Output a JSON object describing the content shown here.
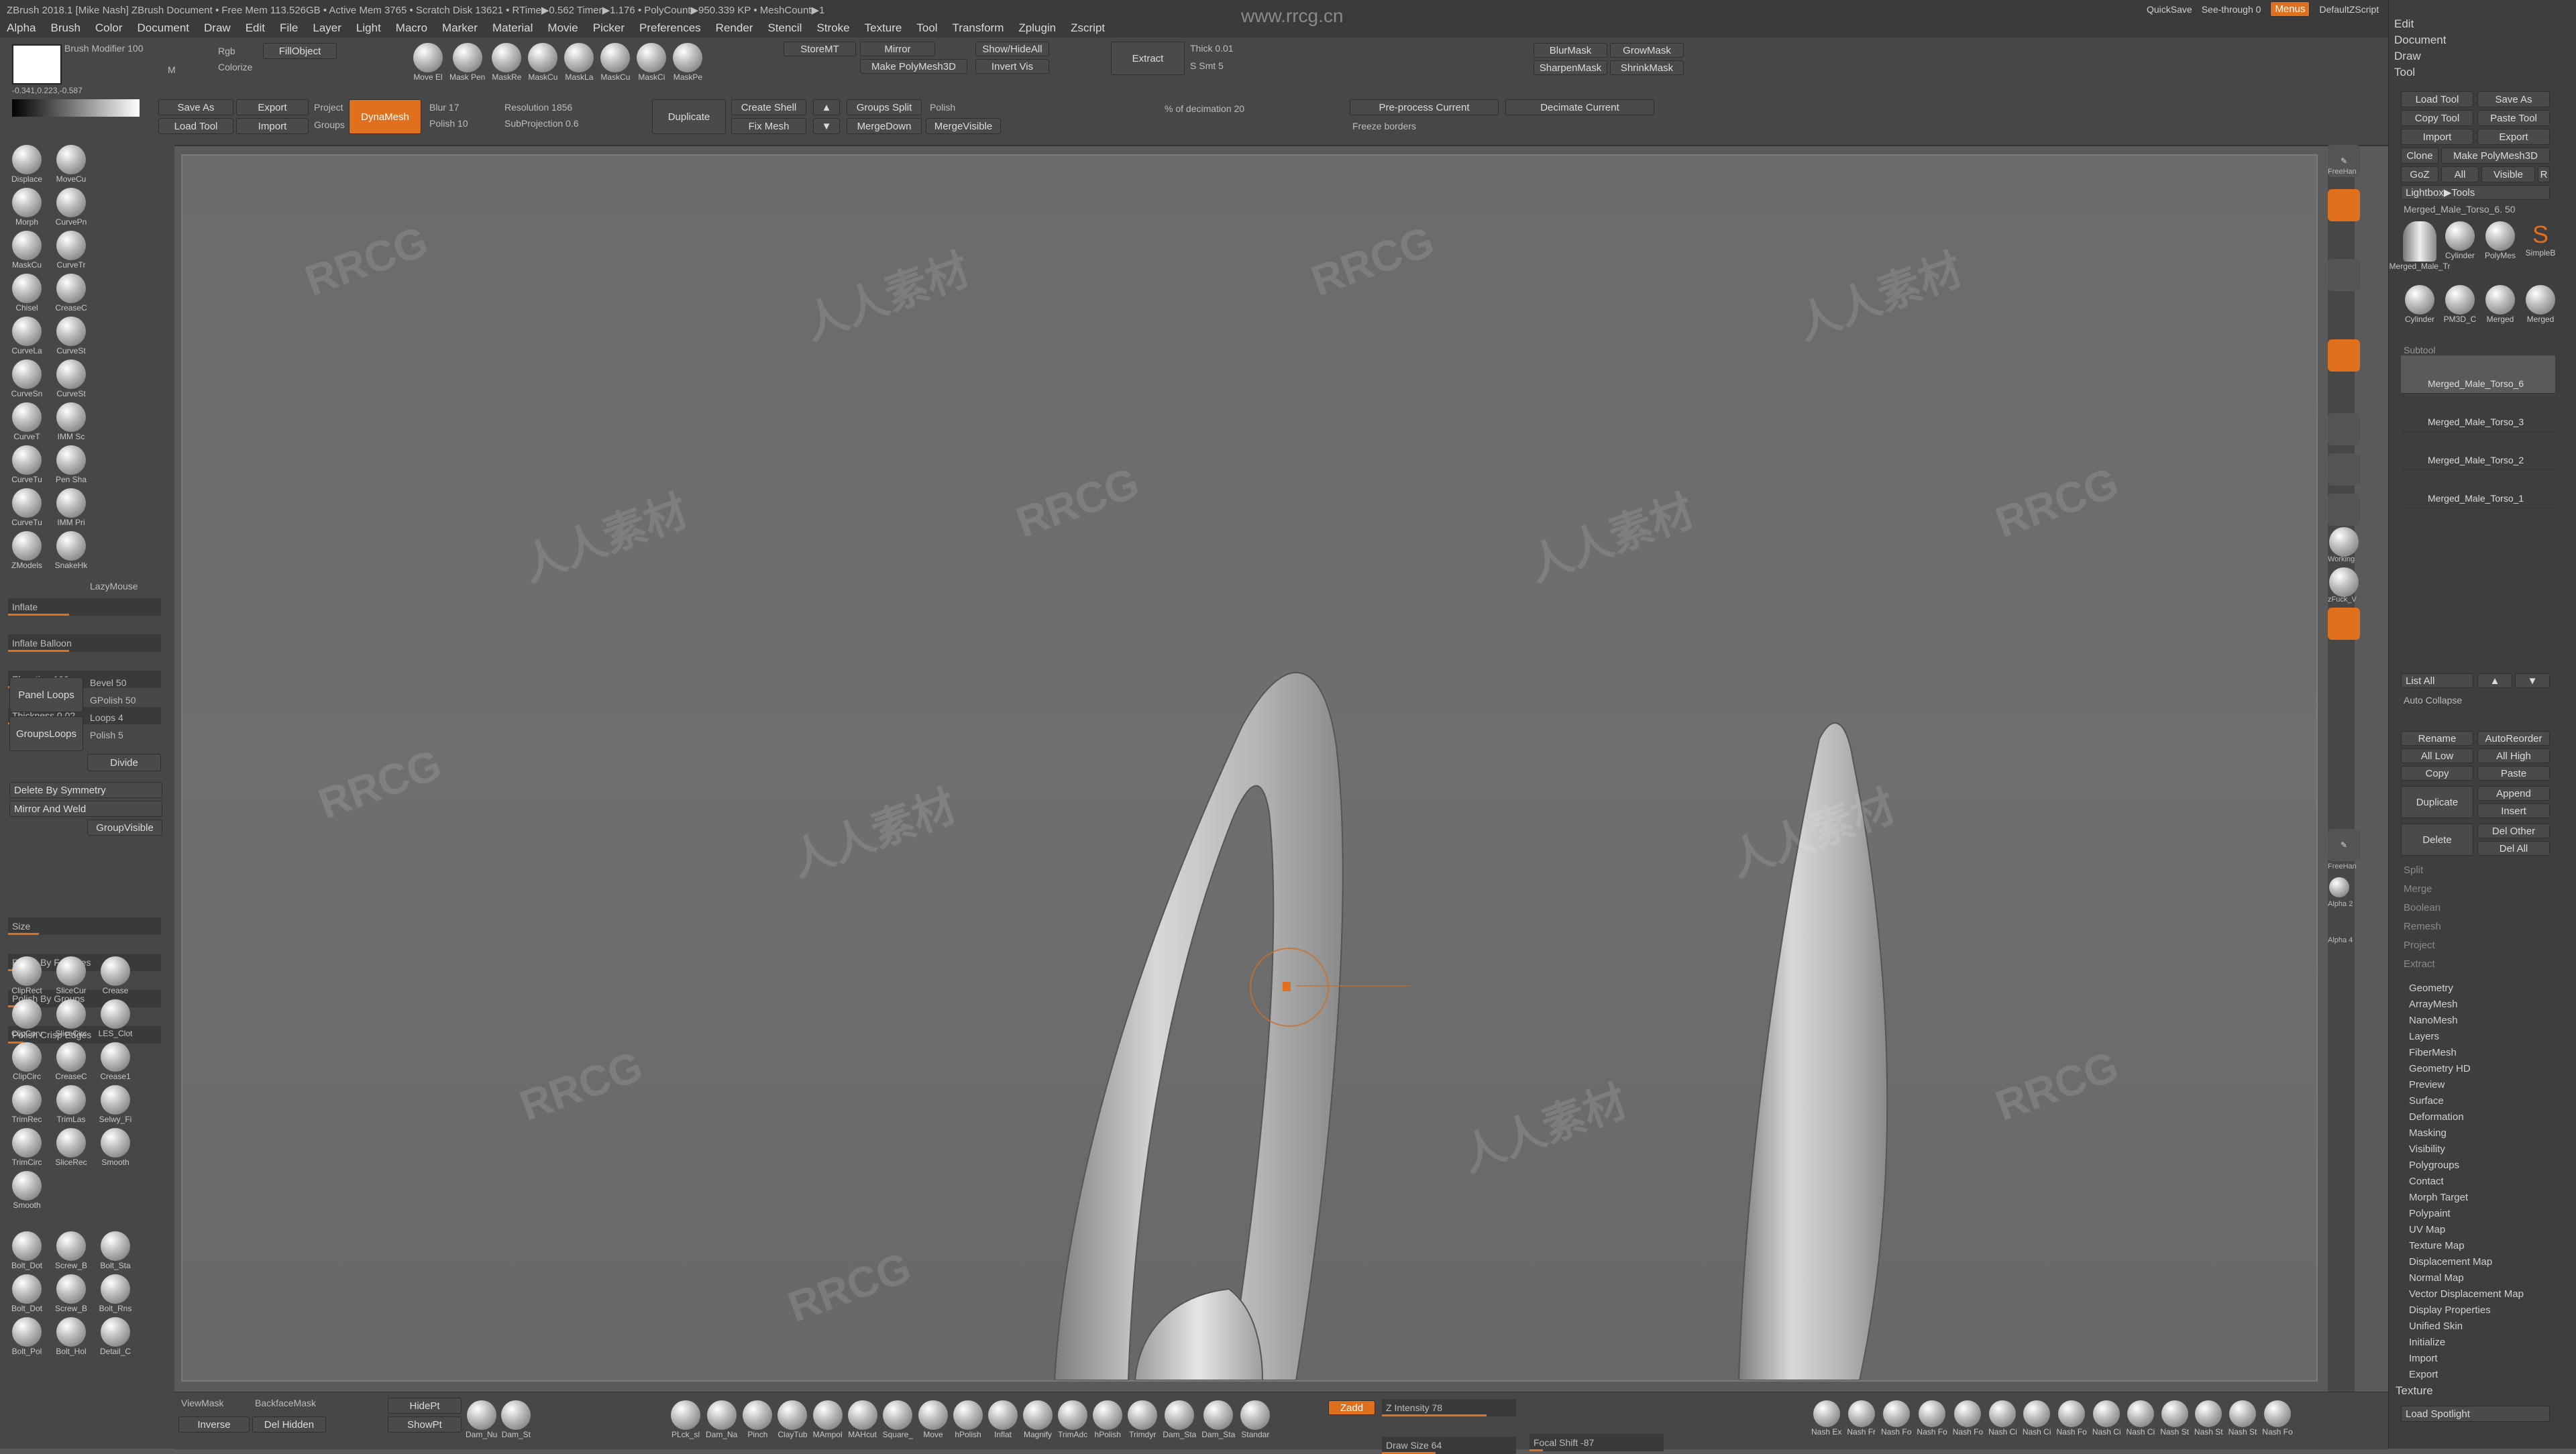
{
  "menubar": {
    "title": "ZBrush 2018.1 [Mike Nash]  ZBrush Document  • Free Mem 113.526GB • Active Mem 3765 • Scratch Disk 13621 • RTime▶0.562 Timer▶1.176 • PolyCount▶950.339 KP • MeshCount▶1",
    "menus": [
      "Alpha",
      "Brush",
      "Color",
      "Document",
      "Draw",
      "Edit",
      "File",
      "Layer",
      "Light",
      "Macro",
      "Marker",
      "Material",
      "Movie",
      "Picker",
      "Preferences",
      "Render",
      "Stencil",
      "Stroke",
      "Texture",
      "Tool",
      "Transform",
      "Zplugin",
      "Zscript"
    ],
    "quicksave": "QuickSave",
    "seethrough": "See-through 0",
    "menus_btn": "Menus",
    "script": "DefaultZScript"
  },
  "watermark": {
    "site": "www.rrcg.cn",
    "brand": "RRCG",
    "cn": "人人素材"
  },
  "topshelf": {
    "brush_modifier": "Brush Modifier 100",
    "rgb": "Rgb",
    "colorize": "Colorize",
    "m": "M",
    "fillobject": "FillObject",
    "coords": "-0.341,0.223,-0.587",
    "save_as": "Save As",
    "export": "Export",
    "load_tool": "Load Tool",
    "import": "Import",
    "project": "Project",
    "groups": "Groups",
    "dynamesh": "DynaMesh",
    "blur": "Blur 17",
    "polish": "Polish 10",
    "resolution": "Resolution 1856",
    "subprojection": "SubProjection 0.6",
    "duplicate": "Duplicate",
    "create_shell": "Create Shell",
    "fix_mesh": "Fix Mesh",
    "groups_split": "Groups Split",
    "polish2": "Polish",
    "mergedown": "MergeDown",
    "mergevisible": "MergeVisible",
    "storemt": "StoreMT",
    "mirror": "Mirror",
    "make_polymesh": "Make PolyMesh3D",
    "show_hide_all": "Show/HideAll",
    "invert_vis": "Invert Vis",
    "extract": "Extract",
    "thick": "Thick 0.01",
    "s_smt": "S Smt 5",
    "pct_decimation": "% of decimation 20",
    "preprocess": "Pre-process Current",
    "decimate": "Decimate Current",
    "freeze_borders": "Freeze borders",
    "blurmask": "BlurMask",
    "growmask": "GrowMask",
    "sharpenmask": "SharpenMask",
    "shrinkmask": "ShrinkMask",
    "brushes_top": [
      "Move El",
      "Mask Pen",
      "MaskRe",
      "MaskCu",
      "MaskLa",
      "MaskCu",
      "MaskCi",
      "MaskPe"
    ]
  },
  "leftshelf": {
    "brushes1": [
      "Displace",
      "MoveCu",
      "Morph",
      "CurvePn",
      "MaskCu",
      "CurveTr",
      "Chisel",
      "CreaseC",
      "CurveLa",
      "CurveSt",
      "CurveSn",
      "CurveSt",
      "CurveT",
      "IMM Sc",
      "CurveTu",
      "Pen Sha",
      "CurveTu",
      "IMM Pri",
      "ZModels",
      "SnakeHk"
    ],
    "lazymouse": "LazyMouse",
    "inflate": "Inflate",
    "inflate_balloon": "Inflate Balloon",
    "elevation": "Elevation 100",
    "thickness": "Thickness 0.02",
    "panel_loops": "Panel Loops",
    "bevel": "Bevel 50",
    "gpolish": "GPolish 50",
    "loops": "Loops 4",
    "polish": "Polish 5",
    "groupsloops": "GroupsLoops",
    "divide": "Divide",
    "delete_by_symmetry": "Delete By Symmetry",
    "mirror_and_weld": "Mirror And Weld",
    "groupvisible": "GroupVisible",
    "size": "Size",
    "polish_features": "Polish By Features",
    "polish_groups": "Polish By Groups",
    "polish_crisp": "Polish Crisp Edges",
    "brushes2": [
      "ClipRect",
      "SliceCur",
      "Crease",
      "ClipCurv",
      "SliceCirc",
      "LES_Clot",
      "ClipCirc",
      "CreaseC",
      "Crease1",
      "TrimRec",
      "TrimLas",
      "Selwy_Fi",
      "TrimCirc",
      "SliceRec",
      "Smooth",
      "Smooth"
    ],
    "brushes3": [
      "Bolt_Dot",
      "Screw_B",
      "Bolt_Sta",
      "Bolt_Dot",
      "Screw_B",
      "Bolt_Rns",
      "Bolt_Pol",
      "Bolt_Hol",
      "Detail_C"
    ]
  },
  "bottomshelf": {
    "viewmask": "ViewMask",
    "backfacemask": "BackfaceMask",
    "inverse": "Inverse",
    "del_hidden": "Del Hidden",
    "hidept": "HidePt",
    "showpt": "ShowPt",
    "brushes": [
      "Dam_Nu",
      "Dam_St",
      "PLck_sl",
      "Dam_Na",
      "Pinch",
      "ClayTub",
      "MAmpol",
      "MAHcut",
      "Square_",
      "Move",
      "hPolish",
      "Inflat",
      "Magnify",
      "TrimAdc",
      "hPolish",
      "Trimdyr",
      "Dam_Sta",
      "Dam_Sta",
      "Standar"
    ],
    "zadd": "Zadd",
    "z_intensity": "Z Intensity 78",
    "draw_size": "Draw Size 64",
    "focal_shift": "Focal Shift -87",
    "right_brushes": [
      "Nash Ex",
      "Nash Fr",
      "Nash Fo",
      "Nash Fo",
      "Nash Fo",
      "Nash Ci",
      "Nash Ci",
      "Nash Fo",
      "Nash Ci",
      "Nash Ci",
      "Nash St",
      "Nash St",
      "Nash St",
      "Nash Fo"
    ]
  },
  "rightnav": {
    "freehand": "FreeHan",
    "working": "Working",
    "zfuck": "zFuck_V",
    "alpha": "Alpha 2",
    "alpha4": "Alpha 4"
  },
  "rightpanel": {
    "headers": [
      "Edit",
      "Document",
      "Draw",
      "Tool"
    ],
    "load_tool": "Load Tool",
    "save_as": "Save As",
    "copy_tool": "Copy Tool",
    "paste_tool": "Paste Tool",
    "import": "Import",
    "export": "Export",
    "clone": "Clone",
    "make_polymesh": "Make PolyMesh3D",
    "goz": "GoZ",
    "all": "All",
    "visible": "Visible",
    "r": "R",
    "lightbox_tools": "Lightbox▶Tools",
    "current_tool": "Merged_Male_Torso_6. 50",
    "tool_thumbs": [
      "Merged_Male_Tr",
      "Cylinder",
      "PolyMes",
      "SimpleB",
      "Cylinder",
      "PM3D_C",
      "Merged",
      "Merged"
    ],
    "subtool": "Subtool",
    "subtools": [
      "Merged_Male_Torso_6",
      "Merged_Male_Torso_3",
      "Merged_Male_Torso_2",
      "Merged_Male_Torso_1"
    ],
    "list_all": "List All",
    "auto_collapse": "Auto Collapse",
    "rename": "Rename",
    "autoreorder": "AutoReorder",
    "all_low": "All Low",
    "all_high": "All High",
    "copy": "Copy",
    "paste": "Paste",
    "duplicate": "Duplicate",
    "append": "Append",
    "insert": "Insert",
    "delete": "Delete",
    "del_other": "Del Other",
    "del_all": "Del All",
    "gray_items": [
      "Split",
      "Merge",
      "Boolean",
      "Remesh",
      "Project",
      "Extract"
    ],
    "sections": [
      "Geometry",
      "ArrayMesh",
      "NanoMesh",
      "Layers",
      "FiberMesh",
      "Geometry HD",
      "Preview",
      "Surface",
      "Deformation",
      "Masking",
      "Visibility",
      "Polygroups",
      "Contact",
      "Morph Target",
      "Polypaint",
      "UV Map",
      "Texture Map",
      "Displacement Map",
      "Normal Map",
      "Vector Displacement Map",
      "Display Properties",
      "Unified Skin",
      "Initialize",
      "Import",
      "Export"
    ],
    "texture": "Texture",
    "load_spotlight": "Load Spotlight"
  },
  "colors": {
    "accent": "#e0701d",
    "panel": "#474747",
    "canvas": "#6b6b6b"
  }
}
